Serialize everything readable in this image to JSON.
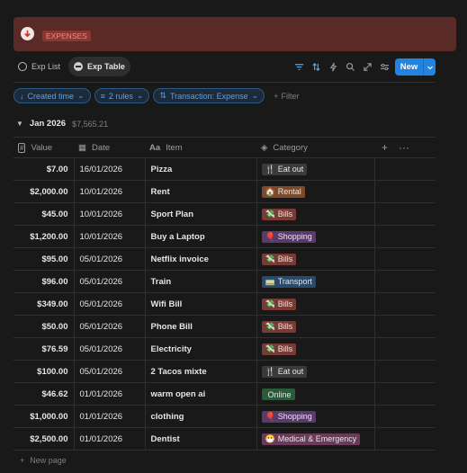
{
  "banner": {
    "tag": "EXPENSES",
    "color": "#5a2a27"
  },
  "tabs": [
    {
      "label": "Exp List",
      "active": false
    },
    {
      "label": "Exp Table",
      "active": true
    }
  ],
  "toolbar": {
    "icons": [
      "filter-icon",
      "sort-icon",
      "lightning-icon",
      "search-icon",
      "expand-icon",
      "settings-icon"
    ],
    "new_label": "New"
  },
  "filters": {
    "created_time": "Created time",
    "rules": "2 rules",
    "transaction": "Transaction: Expense",
    "add_filter": "Filter"
  },
  "group": {
    "name": "Jan 2026",
    "sum": "$7,565.21"
  },
  "columns": {
    "value": "Value",
    "date": "Date",
    "item": "Item",
    "category": "Category"
  },
  "rows": [
    {
      "value": "$7.00",
      "date": "16/01/2026",
      "item": "Pizza",
      "category": "Eat out",
      "cat_color": "#3a3a3a",
      "cat_icon": "🍴"
    },
    {
      "value": "$2,000.00",
      "date": "10/01/2026",
      "item": "Rent",
      "category": "Rental",
      "cat_color": "#7a4a2a",
      "cat_icon": "🏠"
    },
    {
      "value": "$45.00",
      "date": "10/01/2026",
      "item": "Sport Plan",
      "category": "Bills",
      "cat_color": "#7a3a34",
      "cat_icon": "💸"
    },
    {
      "value": "$1,200.00",
      "date": "10/01/2026",
      "item": "Buy a Laptop",
      "category": "Shopping",
      "cat_color": "#5a3a6a",
      "cat_icon": "🎈"
    },
    {
      "value": "$95.00",
      "date": "05/01/2026",
      "item": "Netflix invoice",
      "category": "Bills",
      "cat_color": "#7a3a34",
      "cat_icon": "💸"
    },
    {
      "value": "$96.00",
      "date": "05/01/2026",
      "item": "Train",
      "category": "Transport",
      "cat_color": "#2a4a6a",
      "cat_icon": "🚃"
    },
    {
      "value": "$349.00",
      "date": "05/01/2026",
      "item": "Wifi Bill",
      "category": "Bills",
      "cat_color": "#7a3a34",
      "cat_icon": "💸"
    },
    {
      "value": "$50.00",
      "date": "05/01/2026",
      "item": "Phone Bill",
      "category": "Bills",
      "cat_color": "#7a3a34",
      "cat_icon": "💸"
    },
    {
      "value": "$76.59",
      "date": "05/01/2026",
      "item": "Electricity",
      "category": "Bills",
      "cat_color": "#7a3a34",
      "cat_icon": "💸"
    },
    {
      "value": "$100.00",
      "date": "05/01/2026",
      "item": "2 Tacos mixte",
      "category": "Eat out",
      "cat_color": "#3a3a3a",
      "cat_icon": "🍴"
    },
    {
      "value": "$46.62",
      "date": "01/01/2026",
      "item": "warm open ai",
      "category": "Online",
      "cat_color": "#2a5a3a",
      "cat_icon": ""
    },
    {
      "value": "$1,000.00",
      "date": "01/01/2026",
      "item": "clothing",
      "category": "Shopping",
      "cat_color": "#5a3a6a",
      "cat_icon": "🎈"
    },
    {
      "value": "$2,500.00",
      "date": "01/01/2026",
      "item": "Dentist",
      "category": "Medical & Emergency",
      "cat_color": "#6a3a5a",
      "cat_icon": "😷"
    }
  ],
  "footer": {
    "new_page": "New page"
  }
}
